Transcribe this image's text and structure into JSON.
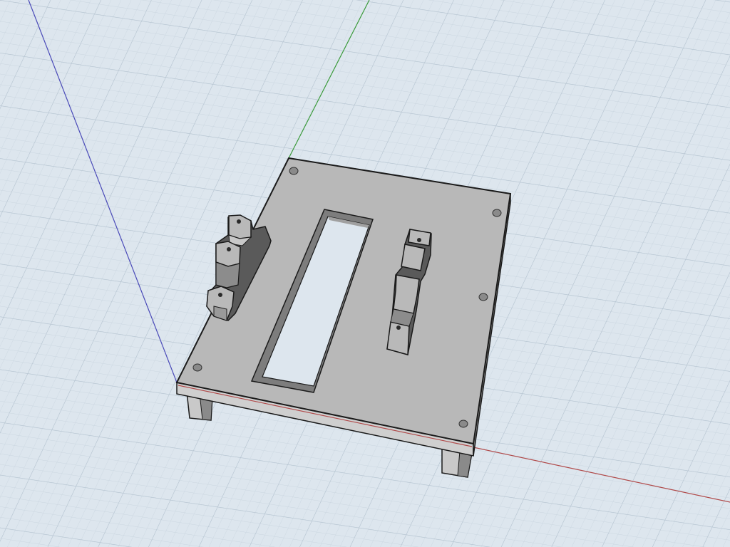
{
  "colors": {
    "background": "#dde6ee",
    "grid_minor": "#c9d5df",
    "grid_major": "#b3c2cf",
    "axis_x": "#b04a4a",
    "axis_y": "#3a9a3a",
    "axis_z": "#4a4ab8",
    "model_top": "#b8b8b8",
    "model_side_dark": "#6e6e6e",
    "model_side_light": "#d4d4d4",
    "outline": "#1a1a1a"
  },
  "icons": {
    "axis_x": "axis-x-line",
    "axis_y": "axis-y-line",
    "axis_z": "axis-z-line"
  }
}
